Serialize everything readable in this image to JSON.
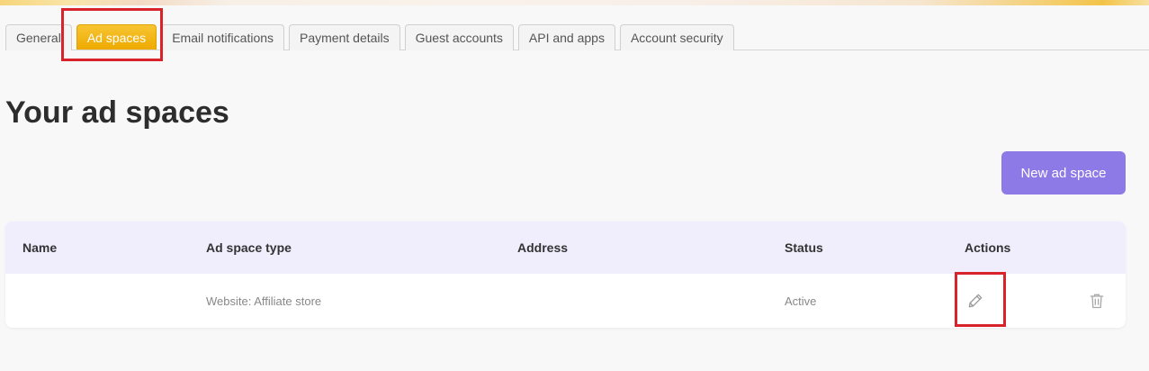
{
  "tabs": [
    {
      "label": "General",
      "active": false
    },
    {
      "label": "Ad spaces",
      "active": true
    },
    {
      "label": "Email notifications",
      "active": false
    },
    {
      "label": "Payment details",
      "active": false
    },
    {
      "label": "Guest accounts",
      "active": false
    },
    {
      "label": "API and apps",
      "active": false
    },
    {
      "label": "Account security",
      "active": false
    }
  ],
  "page": {
    "title": "Your ad spaces",
    "new_button": "New ad space"
  },
  "table": {
    "columns": [
      "Name",
      "Ad space type",
      "Address",
      "Status",
      "Actions"
    ],
    "rows": [
      {
        "name": "",
        "type": "Website: Affiliate store",
        "address": "",
        "status": "Active"
      }
    ]
  },
  "icons": {
    "edit": "pencil-icon",
    "delete": "trash-icon"
  },
  "colors": {
    "active_tab": "#eeaa00",
    "primary_button": "#8d7ae6",
    "table_header_bg": "#f0eefc",
    "highlight": "#d9232a"
  }
}
